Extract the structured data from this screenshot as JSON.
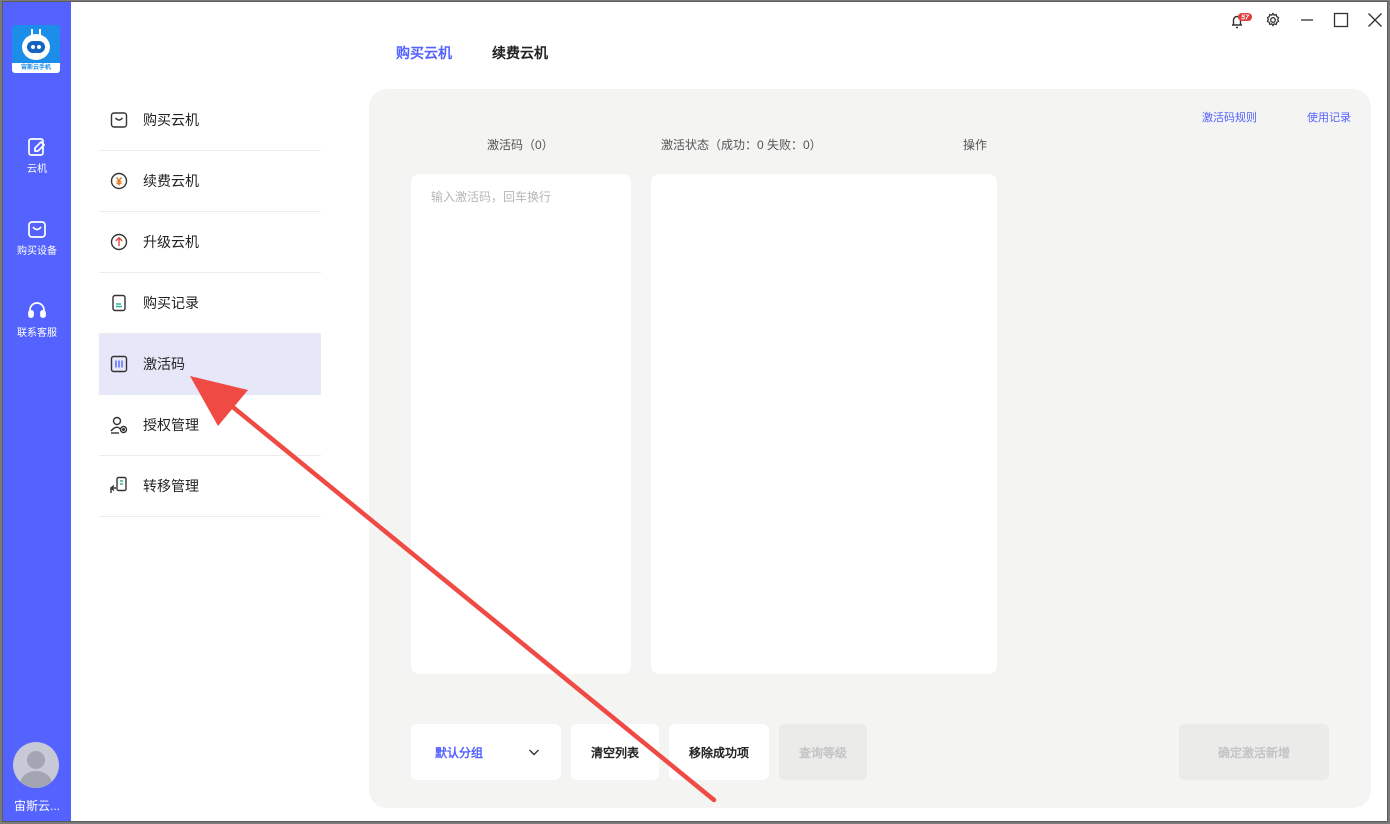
{
  "app": {
    "logo_text": "宙斯云手机",
    "user_name": "宙斯云...",
    "notification_count": "57"
  },
  "rail": {
    "items": [
      {
        "label": "云机",
        "icon": "cloud-phone-icon"
      },
      {
        "label": "购买设备",
        "icon": "shopping-bag-icon"
      },
      {
        "label": "联系客服",
        "icon": "headset-icon"
      }
    ]
  },
  "menu": {
    "items": [
      {
        "label": "购买云机",
        "icon": "cart-icon",
        "active": false
      },
      {
        "label": "续费云机",
        "icon": "yuan-coin-icon",
        "active": false
      },
      {
        "label": "升级云机",
        "icon": "upgrade-arrow-icon",
        "active": false
      },
      {
        "label": "购买记录",
        "icon": "document-icon",
        "active": false
      },
      {
        "label": "激活码",
        "icon": "barcode-icon",
        "active": true
      },
      {
        "label": "授权管理",
        "icon": "user-auth-icon",
        "active": false
      },
      {
        "label": "转移管理",
        "icon": "transfer-icon",
        "active": false
      }
    ]
  },
  "tabs": [
    {
      "label": "购买云机",
      "active": true
    },
    {
      "label": "续费云机",
      "active": false
    }
  ],
  "links": {
    "rules": "激活码规则",
    "history": "使用记录"
  },
  "columns": {
    "code": "激活码（0）",
    "status": "激活状态（成功：0 失败：0）",
    "action": "操作"
  },
  "code_input": {
    "placeholder": "输入激活码，回车换行",
    "value": ""
  },
  "buttons": {
    "group_select": "默认分组",
    "clear": "清空列表",
    "remove_success": "移除成功项",
    "query_level": "查询等级",
    "confirm": "确定激活新增"
  },
  "colors": {
    "accent": "#5463ff",
    "rail": "#5463ff",
    "card_bg": "#f4f4f3",
    "active_menu_bg": "#e6e7f8",
    "annotation_arrow": "#f04a45"
  }
}
